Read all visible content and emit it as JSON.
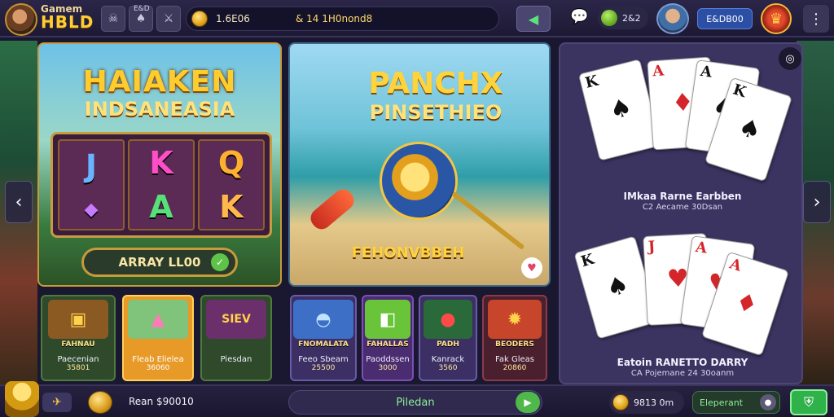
{
  "header": {
    "logo_line1": "Gamem",
    "logo_line2": "HBLD",
    "mini_label": "E&D",
    "coins_value": "1.6E06",
    "coins_secondary": "& 14 1H0nond8",
    "gems_value": "2&2",
    "username": "E&DB00"
  },
  "panels": {
    "slots": {
      "title1": "HAIAKEN",
      "title2": "INDSANEASIA",
      "reel_symbols": [
        "J",
        "K",
        "Q",
        "A",
        "A",
        "K"
      ],
      "button_label": "ARRAY LL00"
    },
    "fish": {
      "title1": "PANCHX",
      "title2": "PINSETHIEO",
      "banner": "FEHONVBBEH"
    },
    "cards": {
      "caption1_line1": "IMkaa Rarne Earbben",
      "caption1_line2": "C2 Aecame 30Dsan",
      "caption2_line1": "Eatoin RANETTO DARRY",
      "caption2_line2": "CA Pojemane 24 30oanm",
      "top_cards": [
        {
          "rank": "K",
          "suit": "♠",
          "color": "black"
        },
        {
          "rank": "A",
          "suit": "♦",
          "color": "red"
        },
        {
          "rank": "A",
          "suit": "♠",
          "color": "black"
        },
        {
          "rank": "K",
          "suit": "♠",
          "color": "black"
        }
      ],
      "bottom_cards": [
        {
          "rank": "K",
          "suit": "♠",
          "color": "black"
        },
        {
          "rank": "J",
          "suit": "♥",
          "color": "red"
        },
        {
          "rank": "A",
          "suit": "♥",
          "color": "red"
        },
        {
          "rank": "A",
          "suit": "♦",
          "color": "red"
        }
      ]
    }
  },
  "tiles": [
    {
      "tag": "FAHNAU",
      "name": "Paecenian",
      "value": "35801"
    },
    {
      "tag": "",
      "name": "Fleab Elielea",
      "value": "36060"
    },
    {
      "tag": "",
      "name": "Piesdan",
      "value": ""
    },
    {
      "tag": "FNOMALATA",
      "name": "Feeo Sbeam",
      "value": "25500"
    },
    {
      "tag": "FAHALLAS",
      "name": "Paoddssen",
      "value": "3000"
    },
    {
      "tag": "PADH",
      "name": "Kanrack",
      "value": "3560"
    },
    {
      "tag": "BEODERS",
      "name": "Fak Gleas",
      "value": "20860"
    }
  ],
  "footer": {
    "balance": "Rean $90010",
    "center_label": "Piledan",
    "coin_value": "9813 0m",
    "deposit_label": "Eleperant"
  },
  "colors": {
    "gold": "#ffcc2e",
    "accent_green": "#4fb84a",
    "background": "#1a1730"
  }
}
